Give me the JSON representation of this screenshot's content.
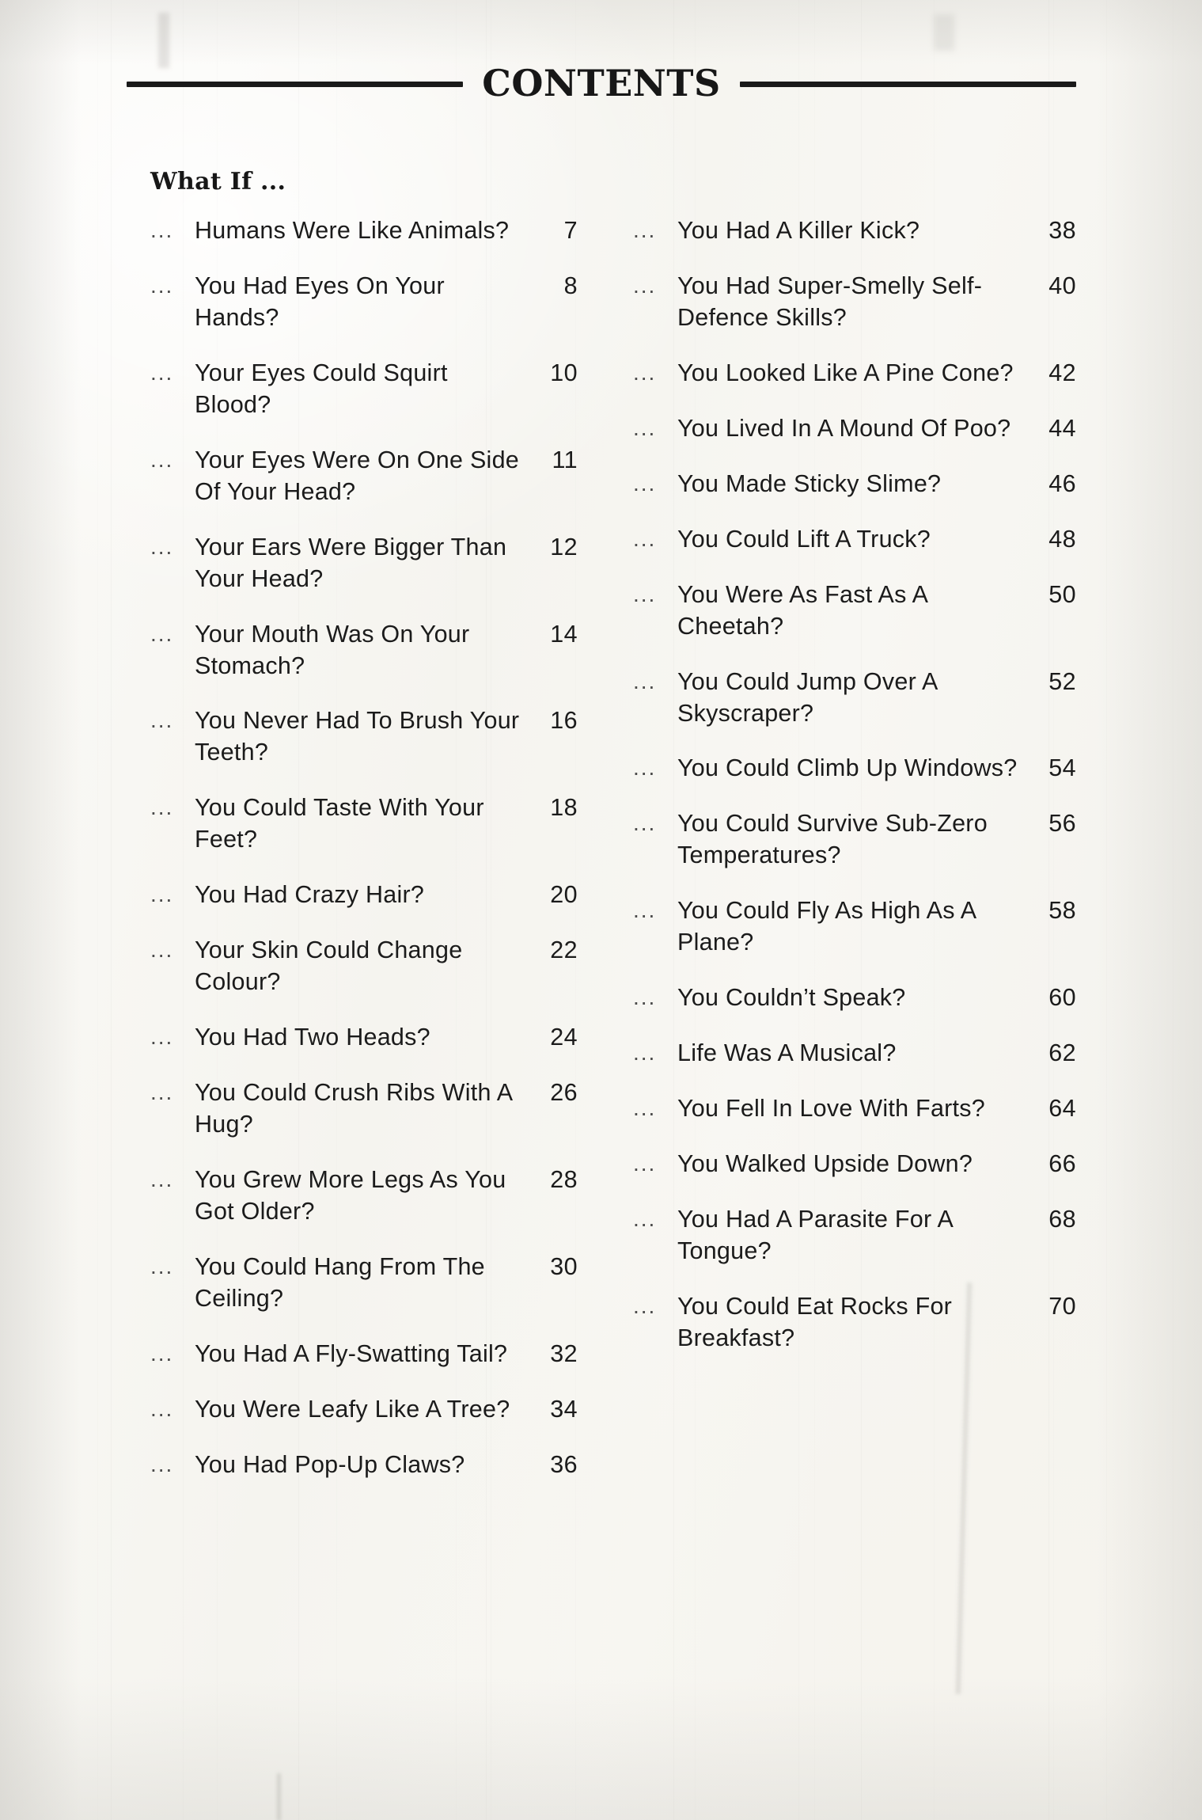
{
  "page": {
    "header_title": "CONTENTS",
    "section_heading": "What If ...",
    "dots": "...",
    "paper_color": "#f7f6f2",
    "ink_color": "#1b1b1b"
  },
  "columns": {
    "left": [
      {
        "dots": "...",
        "title": "Humans Were Like Animals?",
        "page": "7"
      },
      {
        "dots": "...",
        "title": "You Had Eyes On Your Hands?",
        "page": "8"
      },
      {
        "dots": "...",
        "title": "Your Eyes Could Squirt Blood?",
        "page": "10"
      },
      {
        "dots": "...",
        "title": "Your Eyes Were On One Side Of Your Head?",
        "page": "11"
      },
      {
        "dots": "...",
        "title": "Your Ears Were Bigger Than Your Head?",
        "page": "12"
      },
      {
        "dots": "...",
        "title": "Your Mouth Was On Your Stomach?",
        "page": "14"
      },
      {
        "dots": "...",
        "title": "You Never Had To Brush Your Teeth?",
        "page": "16"
      },
      {
        "dots": "...",
        "title": "You Could Taste With Your Feet?",
        "page": "18"
      },
      {
        "dots": "...",
        "title": "You Had Crazy Hair?",
        "page": "20"
      },
      {
        "dots": "...",
        "title": "Your Skin Could Change Colour?",
        "page": "22"
      },
      {
        "dots": "...",
        "title": "You Had Two Heads?",
        "page": "24"
      },
      {
        "dots": "...",
        "title": "You Could Crush Ribs With A Hug?",
        "page": "26"
      },
      {
        "dots": "...",
        "title": "You Grew More Legs As You Got Older?",
        "page": "28"
      },
      {
        "dots": "...",
        "title": "You Could Hang From The Ceiling?",
        "page": "30"
      },
      {
        "dots": "...",
        "title": "You Had A Fly-Swatting Tail?",
        "page": "32"
      },
      {
        "dots": "...",
        "title": "You Were Leafy Like A Tree?",
        "page": "34"
      },
      {
        "dots": "...",
        "title": "You Had Pop-Up Claws?",
        "page": "36"
      }
    ],
    "right": [
      {
        "dots": "...",
        "title": "You Had A Killer Kick?",
        "page": "38"
      },
      {
        "dots": "...",
        "title": "You Had Super-Smelly Self-Defence Skills?",
        "page": "40"
      },
      {
        "dots": "...",
        "title": "You Looked Like A Pine Cone?",
        "page": "42"
      },
      {
        "dots": "...",
        "title": "You Lived In A Mound Of Poo?",
        "page": "44"
      },
      {
        "dots": "...",
        "title": "You Made Sticky Slime?",
        "page": "46"
      },
      {
        "dots": "...",
        "title": "You Could Lift A Truck?",
        "page": "48"
      },
      {
        "dots": "...",
        "title": "You Were As Fast As A Cheetah?",
        "page": "50"
      },
      {
        "dots": "...",
        "title": "You Could Jump Over A Skyscraper?",
        "page": "52"
      },
      {
        "dots": "...",
        "title": "You Could Climb Up Windows?",
        "page": "54"
      },
      {
        "dots": "...",
        "title": "You Could Survive Sub-Zero Temperatures?",
        "page": "56"
      },
      {
        "dots": "...",
        "title": "You Could Fly As High As A Plane?",
        "page": "58"
      },
      {
        "dots": "...",
        "title": "You Couldn’t Speak?",
        "page": "60"
      },
      {
        "dots": "...",
        "title": "Life Was A Musical?",
        "page": "62"
      },
      {
        "dots": "...",
        "title": "You Fell In Love With Farts?",
        "page": "64"
      },
      {
        "dots": "...",
        "title": "You Walked Upside Down?",
        "page": "66"
      },
      {
        "dots": "...",
        "title": "You Had A Parasite For A Tongue?",
        "page": "68"
      },
      {
        "dots": "...",
        "title": "You Could Eat Rocks For Breakfast?",
        "page": "70"
      }
    ]
  }
}
